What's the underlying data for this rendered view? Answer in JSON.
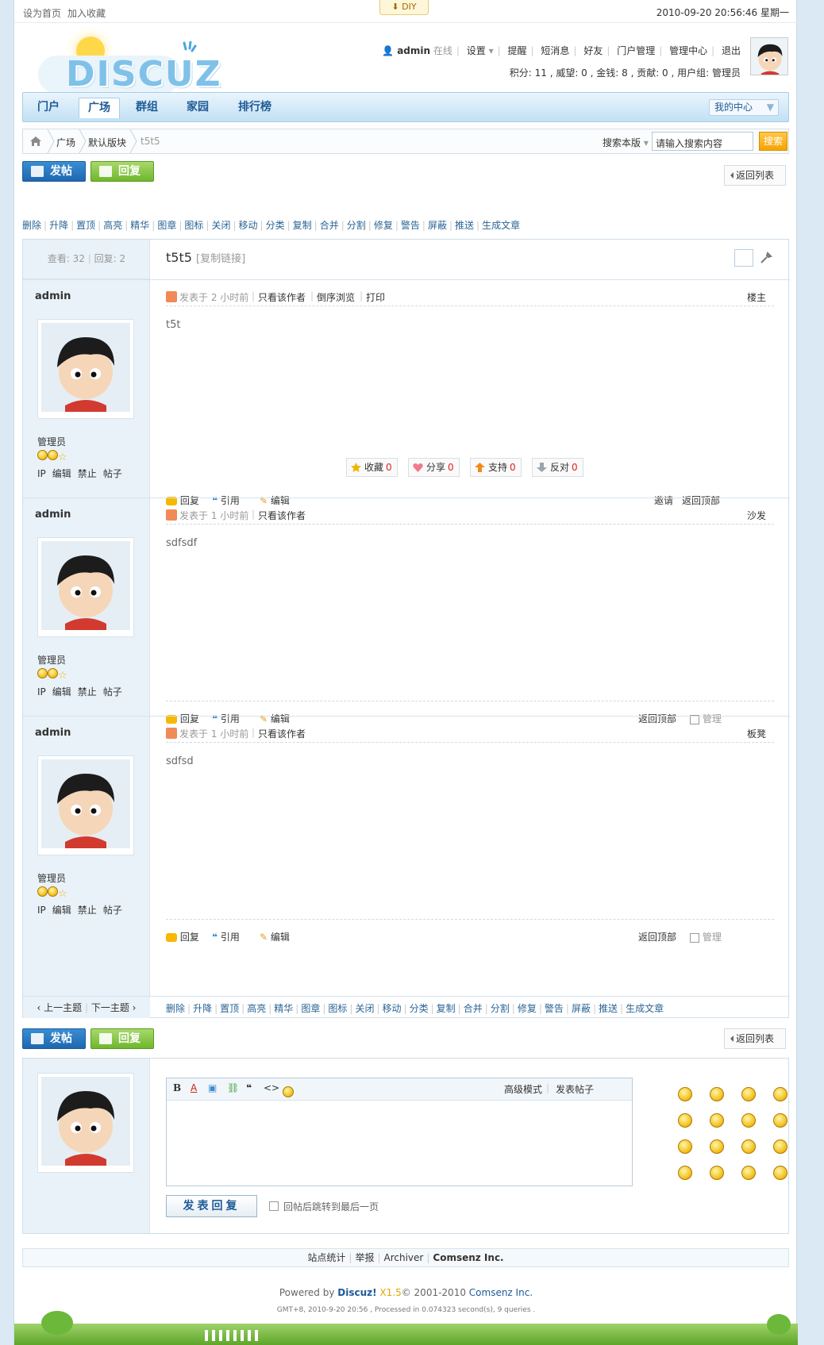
{
  "topbar": {
    "set_home": "设为首页",
    "add_fav": "加入收藏",
    "diy": "DIY",
    "datetime": "2010-09-20 20:56:46 星期一"
  },
  "logo": {
    "text": "DISCUZ"
  },
  "user": {
    "name": "admin",
    "status": "在线",
    "links": [
      "设置",
      "提醒",
      "短消息",
      "好友",
      "门户管理",
      "管理中心",
      "退出"
    ],
    "stats": "积分: 11 , 威望: 0 , 金钱: 8 , 贡献: 0 , 用户组: 管理员"
  },
  "nav": {
    "items": [
      "门户",
      "广场",
      "群组",
      "家园",
      "排行榜"
    ],
    "my_center": "我的中心"
  },
  "crumb": {
    "items": [
      "广场",
      "默认版块",
      "t5t5"
    ],
    "search_scope": "搜索本版",
    "search_placeholder": "请输入搜索内容",
    "search_btn": "搜索"
  },
  "buttons": {
    "post": "发帖",
    "reply": "回复",
    "back": "返回列表"
  },
  "mod_actions": [
    "删除",
    "升降",
    "置顶",
    "高亮",
    "精华",
    "图章",
    "图标",
    "关闭",
    "移动",
    "分类",
    "复制",
    "合并",
    "分割",
    "修复",
    "警告",
    "屏蔽",
    "推送",
    "生成文章"
  ],
  "thread": {
    "views": "查看: 32",
    "replies": "回复: 2",
    "title": "t5t5",
    "copy_link": "[复制链接]"
  },
  "posts": [
    {
      "author": "admin",
      "role": "管理员",
      "ops": [
        "IP",
        "编辑",
        "禁止",
        "帖子"
      ],
      "time": "发表于 2 小时前",
      "view_only": "只看该作者",
      "extra": [
        "倒序浏览",
        "打印"
      ],
      "floor": "楼主",
      "content": "t5t",
      "actions": [
        "回复",
        "引用",
        "编辑"
      ],
      "right_actions": [
        "邀请",
        "返回顶部"
      ]
    },
    {
      "author": "admin",
      "role": "管理员",
      "ops": [
        "IP",
        "编辑",
        "禁止",
        "帖子"
      ],
      "time": "发表于 1 小时前",
      "view_only": "只看该作者",
      "extra": [],
      "floor": "沙发",
      "content": "sdfsdf",
      "actions": [
        "回复",
        "引用",
        "编辑"
      ],
      "right_actions": [
        "返回顶部",
        "管理"
      ]
    },
    {
      "author": "admin",
      "role": "管理员",
      "ops": [
        "IP",
        "编辑",
        "禁止",
        "帖子"
      ],
      "time": "发表于 1 小时前",
      "view_only": "只看该作者",
      "extra": [],
      "floor": "板凳",
      "content": "sdfsd",
      "actions": [
        "回复",
        "引用",
        "编辑"
      ],
      "right_actions": [
        "返回顶部",
        "管理"
      ]
    }
  ],
  "rate": [
    {
      "label": "收藏",
      "count": "0"
    },
    {
      "label": "分享",
      "count": "0"
    },
    {
      "label": "支持",
      "count": "0"
    },
    {
      "label": "反对",
      "count": "0"
    }
  ],
  "pager": {
    "prev": "上一主题",
    "next": "下一主题"
  },
  "editor": {
    "advanced": "高级模式",
    "new_post": "发表帖子",
    "submit": "发表回复",
    "jump_last": "回帖后跳转到最后一页"
  },
  "footer": {
    "links": [
      "站点统计",
      "举报",
      "Archiver",
      "Comsenz Inc."
    ],
    "powered_prefix": "Powered by ",
    "product": "Discuz!",
    "version": "X1.5",
    "copyright": "© 2001-2010 ",
    "company": "Comsenz Inc.",
    "gmt": "GMT+8, 2010-9-20 20:56 , Processed in 0.074323 second(s), 9 queries ."
  }
}
